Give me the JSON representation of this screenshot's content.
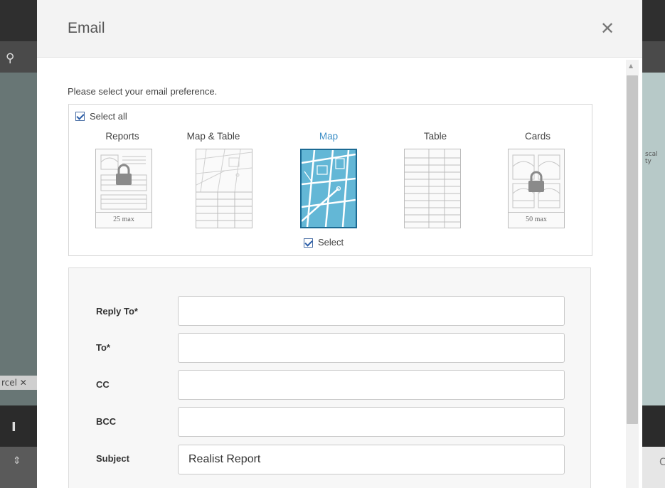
{
  "background": {
    "parcel_tab": "rcel ✕",
    "pin_icon": "map-pin-icon",
    "sort_icon": "sort-icon",
    "right_map_label": "scal\nty",
    "right_row_text": "C"
  },
  "modal": {
    "title": "Email",
    "close_icon": "close-icon"
  },
  "preference": {
    "prompt": "Please select your email preference.",
    "select_all_label": "Select all",
    "options": [
      {
        "label": "Reports",
        "max": "25 max",
        "locked": true
      },
      {
        "label": "Map & Table",
        "max": "",
        "locked": false
      },
      {
        "label": "Map",
        "max": "",
        "locked": false,
        "selected": true
      },
      {
        "label": "Table",
        "max": "",
        "locked": false
      },
      {
        "label": "Cards",
        "max": "50 max",
        "locked": true
      }
    ],
    "map_select_label": "Select"
  },
  "form": {
    "reply_to": {
      "label": "Reply To*",
      "value": ""
    },
    "to": {
      "label": "To*",
      "value": ""
    },
    "cc": {
      "label": "CC",
      "value": ""
    },
    "bcc": {
      "label": "BCC",
      "value": ""
    },
    "subject": {
      "label": "Subject",
      "value": "Realist Report"
    }
  },
  "colors": {
    "accent": "#3d8fc6",
    "map_fill": "#63b7d6",
    "map_border": "#1b6a93",
    "checkbox": "#2a5da8"
  }
}
